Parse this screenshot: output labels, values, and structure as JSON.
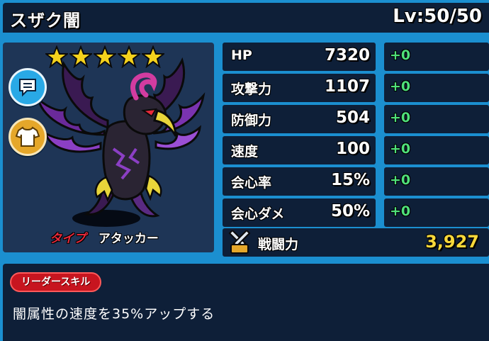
{
  "header": {
    "name": "スザク闇",
    "level": "Lv:50/50"
  },
  "character": {
    "star_count": 5,
    "type_label": "タイプ",
    "type_value": "アタッカー"
  },
  "stats": [
    {
      "label": "HP",
      "value": "7320",
      "bonus": "+0"
    },
    {
      "label": "攻撃力",
      "value": "1107",
      "bonus": "+0"
    },
    {
      "label": "防御力",
      "value": "504",
      "bonus": "+0"
    },
    {
      "label": "速度",
      "value": "100",
      "bonus": "+0"
    },
    {
      "label": "会心率",
      "value": "15%",
      "bonus": "+0"
    },
    {
      "label": "会心ダメ",
      "value": "50%",
      "bonus": "+0"
    }
  ],
  "power": {
    "label": "戦闘力",
    "value": "3,927"
  },
  "leader_skill": {
    "tag": "リーダースキル",
    "description": "闇属性の速度を35%アップする"
  },
  "colors": {
    "frame": "#1b8fd0",
    "panel": "#0e1f38",
    "bonus": "#4fe07a",
    "power": "#f7d83a",
    "type_label": "#e8293a"
  }
}
